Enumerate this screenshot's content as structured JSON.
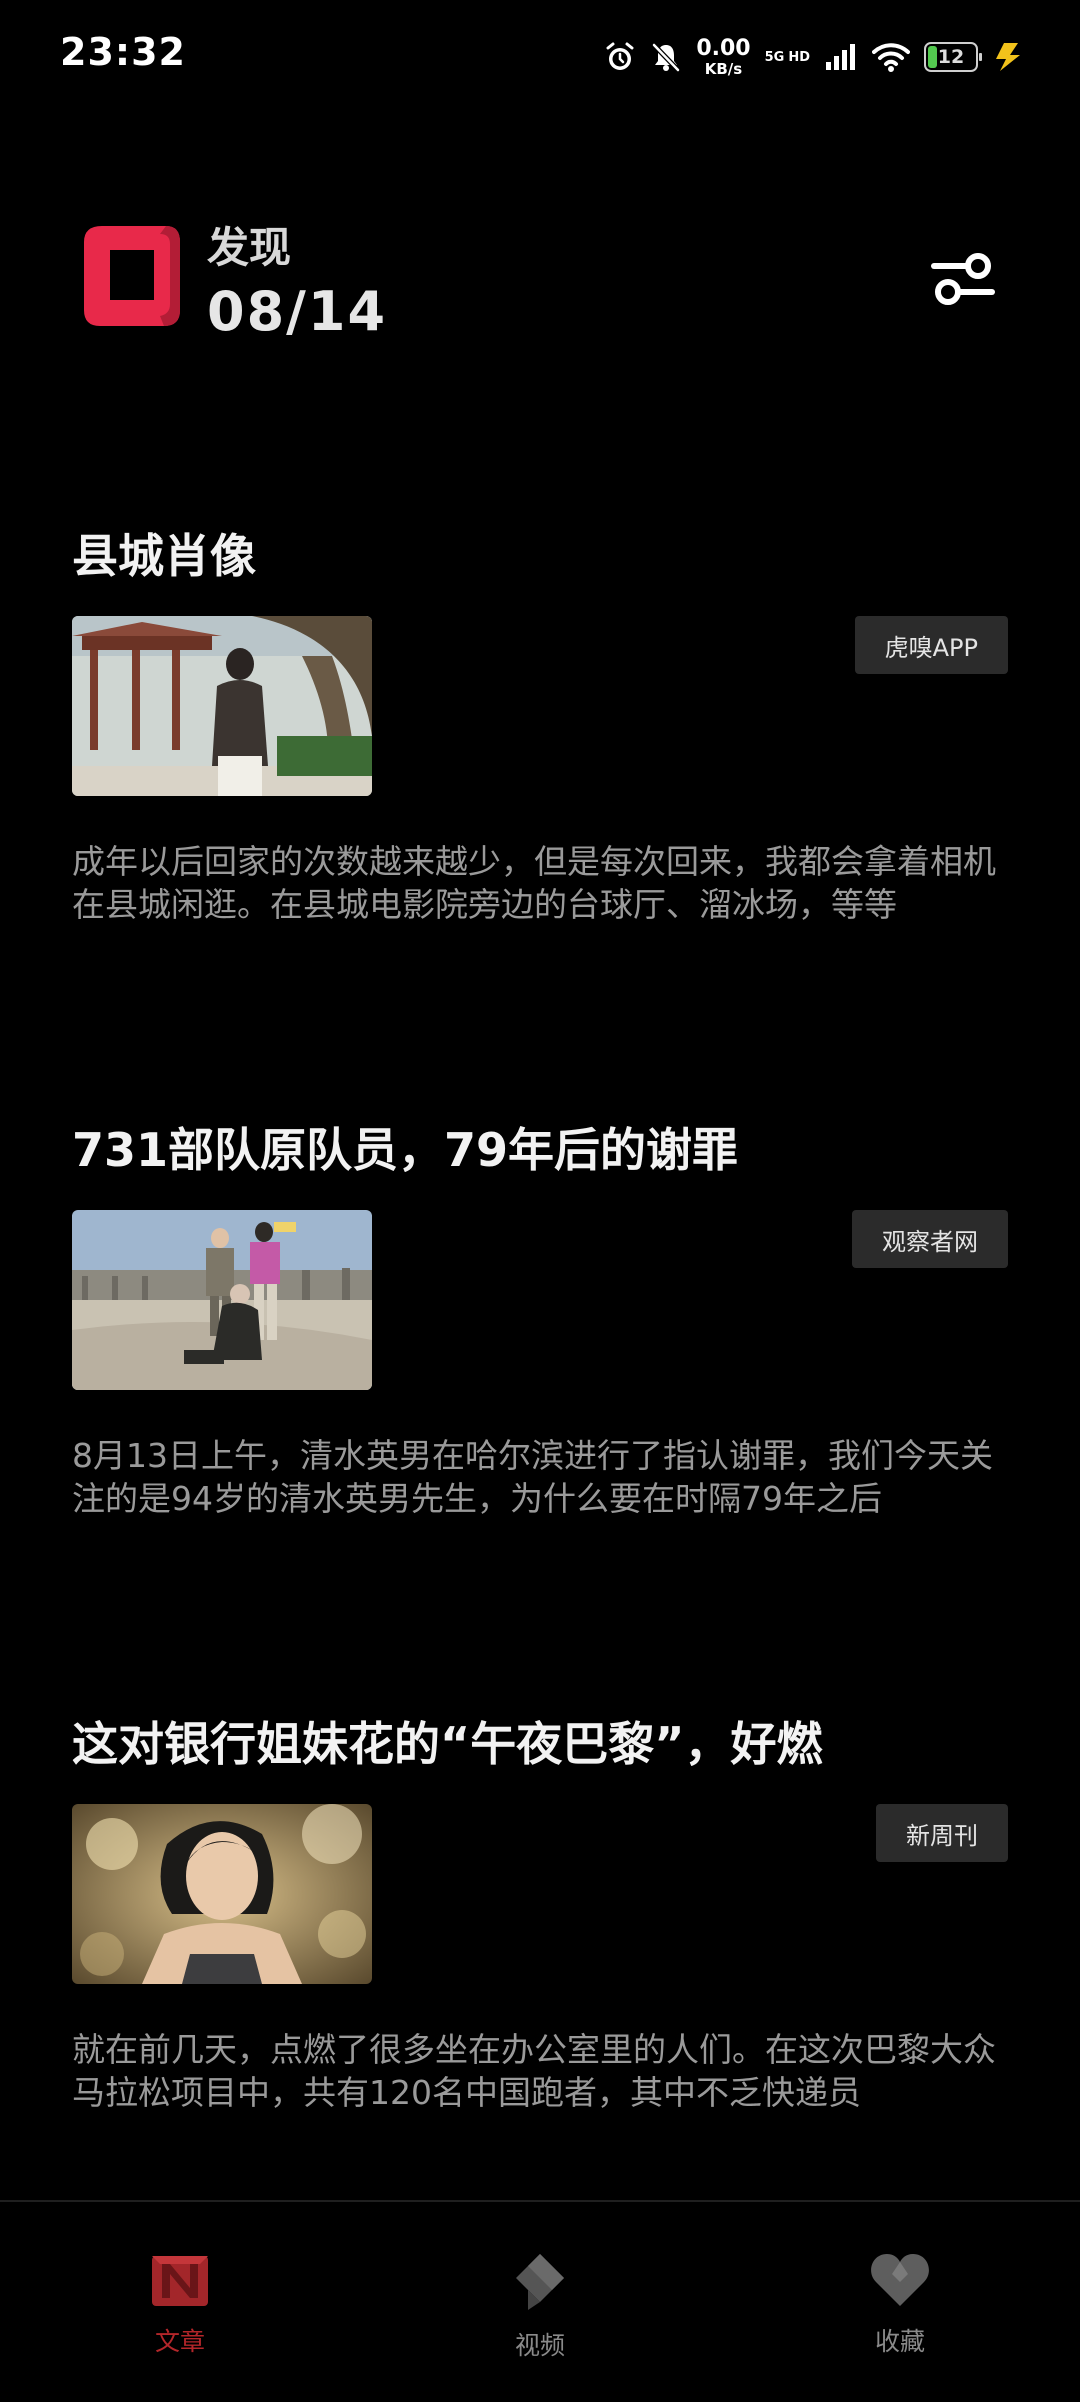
{
  "status_bar": {
    "time": "23:32",
    "net_speed_value": "0.00",
    "net_speed_unit": "KB/s",
    "net_5g": "5G",
    "net_hd": "HD",
    "battery_level": "12",
    "icons": [
      "alarm-icon",
      "mute-icon",
      "signal-icon",
      "wifi-icon",
      "battery-icon",
      "charging-icon"
    ]
  },
  "header": {
    "title": "发现",
    "date": "08/14",
    "logo_color": "#e8294a",
    "filter_icon": "sliders-icon"
  },
  "articles": [
    {
      "title": "县城肖像",
      "source": "虎嗅APP",
      "summary": "成年以后回家的次数越来越少，但是每次回来，我都会拿着相机在县城闲逛。在县城电影院旁边的台球厅、溜冰场，等等",
      "thumb_icon": "photo-pavilion"
    },
    {
      "title": "731部队原队员，79年后的谢罪",
      "source": "观察者网",
      "summary": "8月13日上午，清水英男在哈尔滨进行了指认谢罪，我们今天关注的是94岁的清水英男先生，为什么要在时隔79年之后",
      "thumb_icon": "photo-bridge"
    },
    {
      "title": "这对银行姐妹花的“午夜巴黎”，好燃",
      "source": "新周刊",
      "summary": "就在前几天，点燃了很多坐在办公室里的人们。在这次巴黎大众马拉松项目中，共有120名中国跑者，其中不乏快递员",
      "thumb_icon": "photo-runner"
    }
  ],
  "bottom_nav": {
    "active_color": "#b3262a",
    "items": [
      {
        "label": "文章",
        "icon": "article-icon",
        "active": true
      },
      {
        "label": "视频",
        "icon": "video-icon",
        "active": false
      },
      {
        "label": "收藏",
        "icon": "heart-icon",
        "active": false
      }
    ]
  }
}
